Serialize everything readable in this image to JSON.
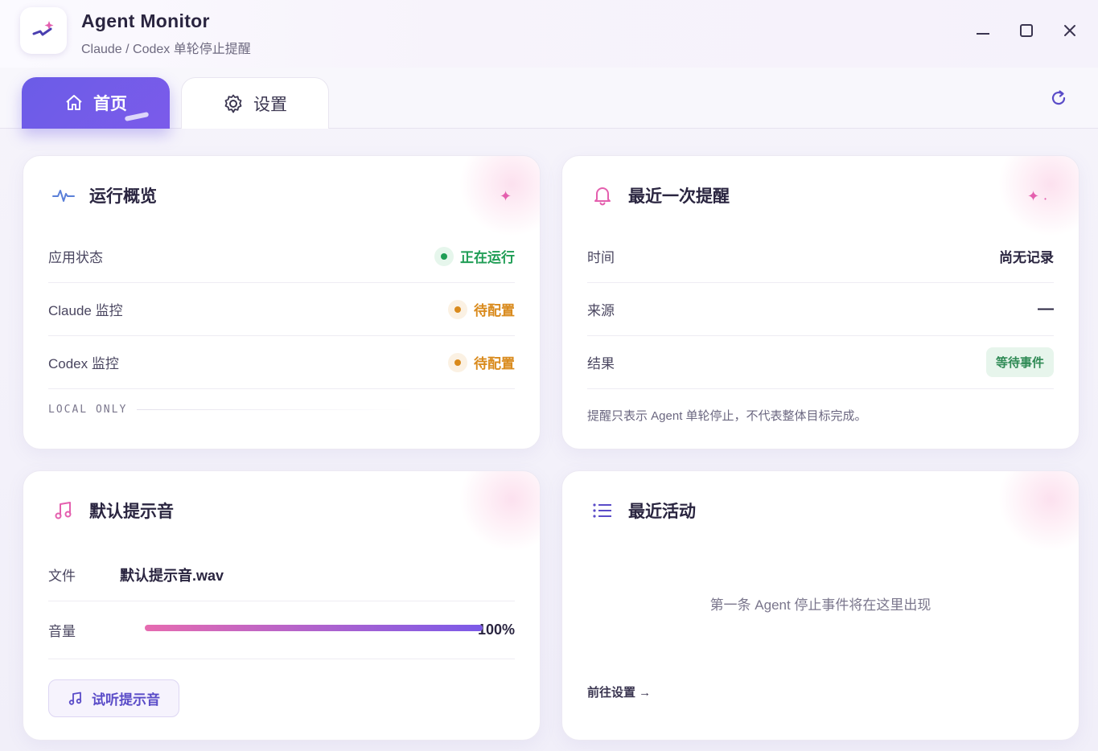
{
  "app": {
    "title": "Agent Monitor",
    "subtitle": "Claude / Codex 单轮停止提醒"
  },
  "tabs": [
    {
      "label": "首页",
      "icon": "home-icon",
      "active": true
    },
    {
      "label": "设置",
      "icon": "gear-icon",
      "active": false
    }
  ],
  "overview": {
    "title": "运行概览",
    "rows": [
      {
        "label": "应用状态",
        "status": "正在运行",
        "color": "#1f9d55"
      },
      {
        "label": "Claude 监控",
        "status": "待配置",
        "color": "#d98a1c"
      },
      {
        "label": "Codex 监控",
        "status": "待配置",
        "color": "#d98a1c"
      }
    ],
    "footer": "LOCAL ONLY"
  },
  "last_alert": {
    "title": "最近一次提醒",
    "rows": [
      {
        "label": "时间",
        "value": "尚无记录"
      },
      {
        "label": "来源",
        "value": "—"
      },
      {
        "label": "结果",
        "value": "等待事件"
      }
    ],
    "note": "提醒只表示 Agent 单轮停止，不代表整体目标完成。"
  },
  "sound": {
    "title": "默认提示音",
    "file_label": "文件",
    "file_value": "默认提示音.wav",
    "volume_label": "音量",
    "volume_value": "100%",
    "volume_fraction": 1.0,
    "preview_button": "试听提示音"
  },
  "activity": {
    "title": "最近活动",
    "empty_text": "第一条 Agent 停止事件将在这里出现",
    "link": "前往设置 →"
  },
  "colors": {
    "accent": "#6b5ce7",
    "success": "#1f9d55",
    "warning": "#d98a1c",
    "pink": "#e45fae"
  }
}
